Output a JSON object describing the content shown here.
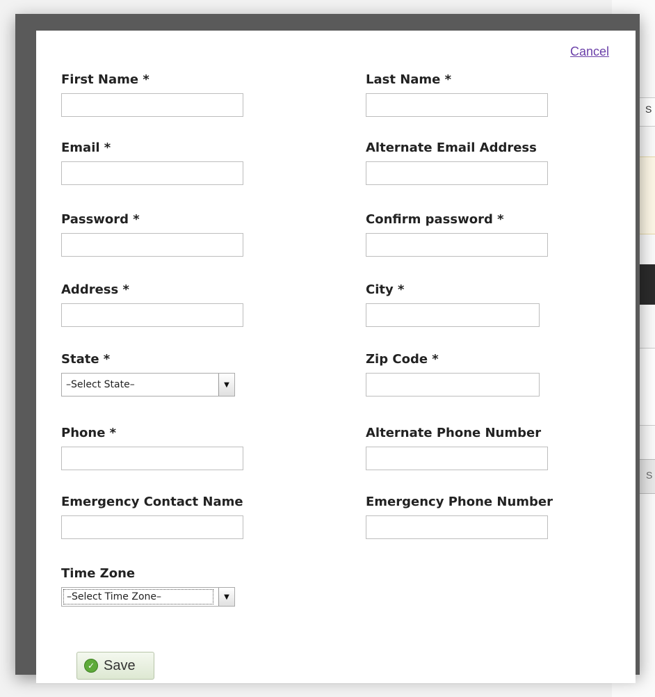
{
  "dialog": {
    "cancel_label": "Cancel",
    "save_label": "Save"
  },
  "fields": {
    "first_name": {
      "label": "First Name *",
      "value": ""
    },
    "last_name": {
      "label": "Last Name *",
      "value": ""
    },
    "email": {
      "label": "Email *",
      "value": ""
    },
    "alternate_email": {
      "label": "Alternate Email Address",
      "value": ""
    },
    "password": {
      "label": "Password *",
      "value": ""
    },
    "confirm_password": {
      "label": "Confirm password *",
      "value": ""
    },
    "address": {
      "label": "Address *",
      "value": ""
    },
    "city": {
      "label": "City *",
      "value": ""
    },
    "state": {
      "label": "State *",
      "selected": "–Select State–"
    },
    "zip_code": {
      "label": "Zip Code *",
      "value": ""
    },
    "phone": {
      "label": "Phone *",
      "value": ""
    },
    "alternate_phone": {
      "label": "Alternate Phone Number",
      "value": ""
    },
    "emergency_contact_name": {
      "label": "Emergency Contact Name",
      "value": ""
    },
    "emergency_phone": {
      "label": "Emergency Phone Number",
      "value": ""
    },
    "time_zone": {
      "label": "Time Zone",
      "selected": "–Select Time Zone–"
    }
  },
  "background": {
    "peek_text_1": "S",
    "peek_text_2": "S"
  },
  "icons": {
    "save": "check-circle-icon",
    "dropdown": "chevron-down-icon",
    "scroll_up": "arrow-up-icon",
    "scroll_down": "arrow-down-icon"
  },
  "colors": {
    "link": "#6a3fa8",
    "scroll_thumb": "#4f8ff0",
    "save_icon": "#5eaa3a"
  }
}
